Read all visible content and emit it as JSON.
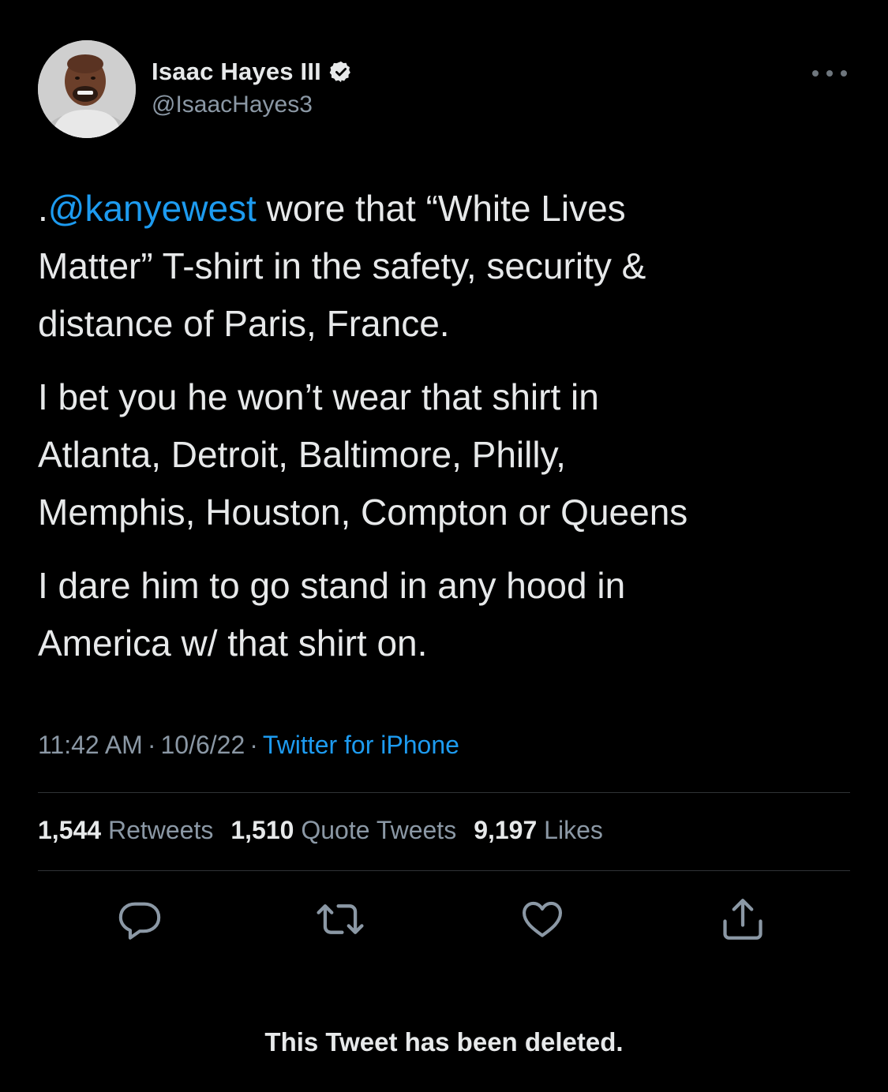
{
  "author": {
    "display_name": "Isaac Hayes III",
    "handle": "@IsaacHayes3",
    "verified_icon": "verified-badge-icon",
    "avatar_icon": "profile-photo"
  },
  "menu": {
    "more_icon": "more-options-icon"
  },
  "tweet": {
    "p1_prefix": ".",
    "p1_mention": "@kanyewest",
    "p1_rest_line1": " wore that “White Lives",
    "p1_line2": "Matter” T-shirt in the safety, security &",
    "p1_line3": "distance of Paris, France.",
    "p2_line1": "I bet you he won’t wear that shirt in",
    "p2_line2": "Atlanta, Detroit, Baltimore, Philly,",
    "p2_line3": "Memphis, Houston, Compton or Queens",
    "p3_line1": "I dare him to go stand in any hood in",
    "p3_line2": "America w/ that shirt on."
  },
  "meta": {
    "time": "11:42 AM",
    "separator": "·",
    "date": "10/6/22",
    "source": "Twitter for iPhone"
  },
  "stats": {
    "retweets_count": "1,544",
    "retweets_label": "Retweets",
    "quotes_count": "1,510",
    "quotes_label": "Quote Tweets",
    "likes_count": "9,197",
    "likes_label": "Likes"
  },
  "actions": [
    "reply-icon",
    "retweet-icon",
    "like-icon",
    "share-icon"
  ],
  "colors": {
    "background": "#000000",
    "text": "#e7e9ea",
    "secondary": "#8b98a5",
    "accent": "#1d9bf0",
    "divider": "#2f3336"
  },
  "footer": {
    "deleted_notice": "This Tweet has been deleted."
  }
}
